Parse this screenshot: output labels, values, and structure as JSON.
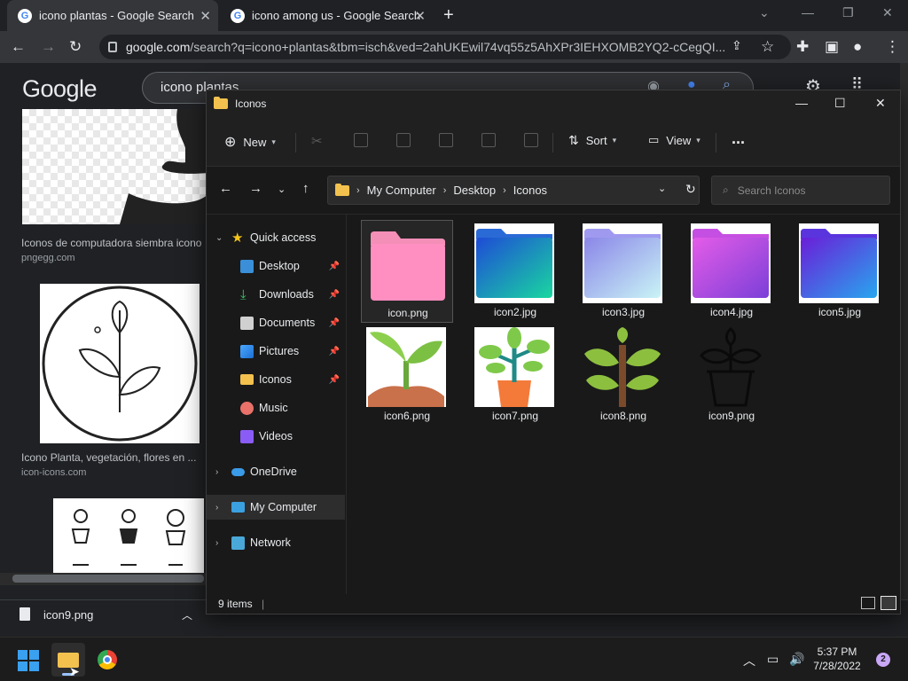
{
  "browser": {
    "tabs": [
      {
        "label": "icono plantas - Google Search"
      },
      {
        "label": "icono among us - Google Search"
      }
    ],
    "omnibox": {
      "host": "google.com",
      "path": "/search?q=icono+plantas&tbm=isch&ved=2ahUKEwil74vq55z5AhXPr3IEHXOMB2YQ2-cCegQI..."
    }
  },
  "google": {
    "logo": "Google",
    "query": "icono plantas",
    "results": [
      {
        "caption": "Iconos de computadora siembra icono",
        "source": "pngegg.com"
      },
      {
        "caption": "Icono Planta, vegetación, flores en ...",
        "source": "icon-icons.com"
      }
    ]
  },
  "explorer": {
    "title": "Iconos",
    "toolbar": {
      "new": "New",
      "sort": "Sort",
      "view": "View",
      "more": "..."
    },
    "breadcrumb": [
      "My Computer",
      "Desktop",
      "Iconos"
    ],
    "search_placeholder": "Search Iconos",
    "nav": {
      "quick_access": "Quick access",
      "items": [
        "Desktop",
        "Downloads",
        "Documents",
        "Pictures",
        "Iconos",
        "Music",
        "Videos"
      ],
      "onedrive": "OneDrive",
      "mycomputer": "My Computer",
      "network": "Network"
    },
    "files": [
      "icon.png",
      "icon2.jpg",
      "icon3.jpg",
      "icon4.jpg",
      "icon5.jpg",
      "icon6.png",
      "icon7.png",
      "icon8.png",
      "icon9.png"
    ],
    "status": "9 items"
  },
  "downloads": {
    "file": "icon9.png"
  },
  "taskbar": {
    "time": "5:37 PM",
    "date": "7/28/2022",
    "notifications": "2"
  }
}
